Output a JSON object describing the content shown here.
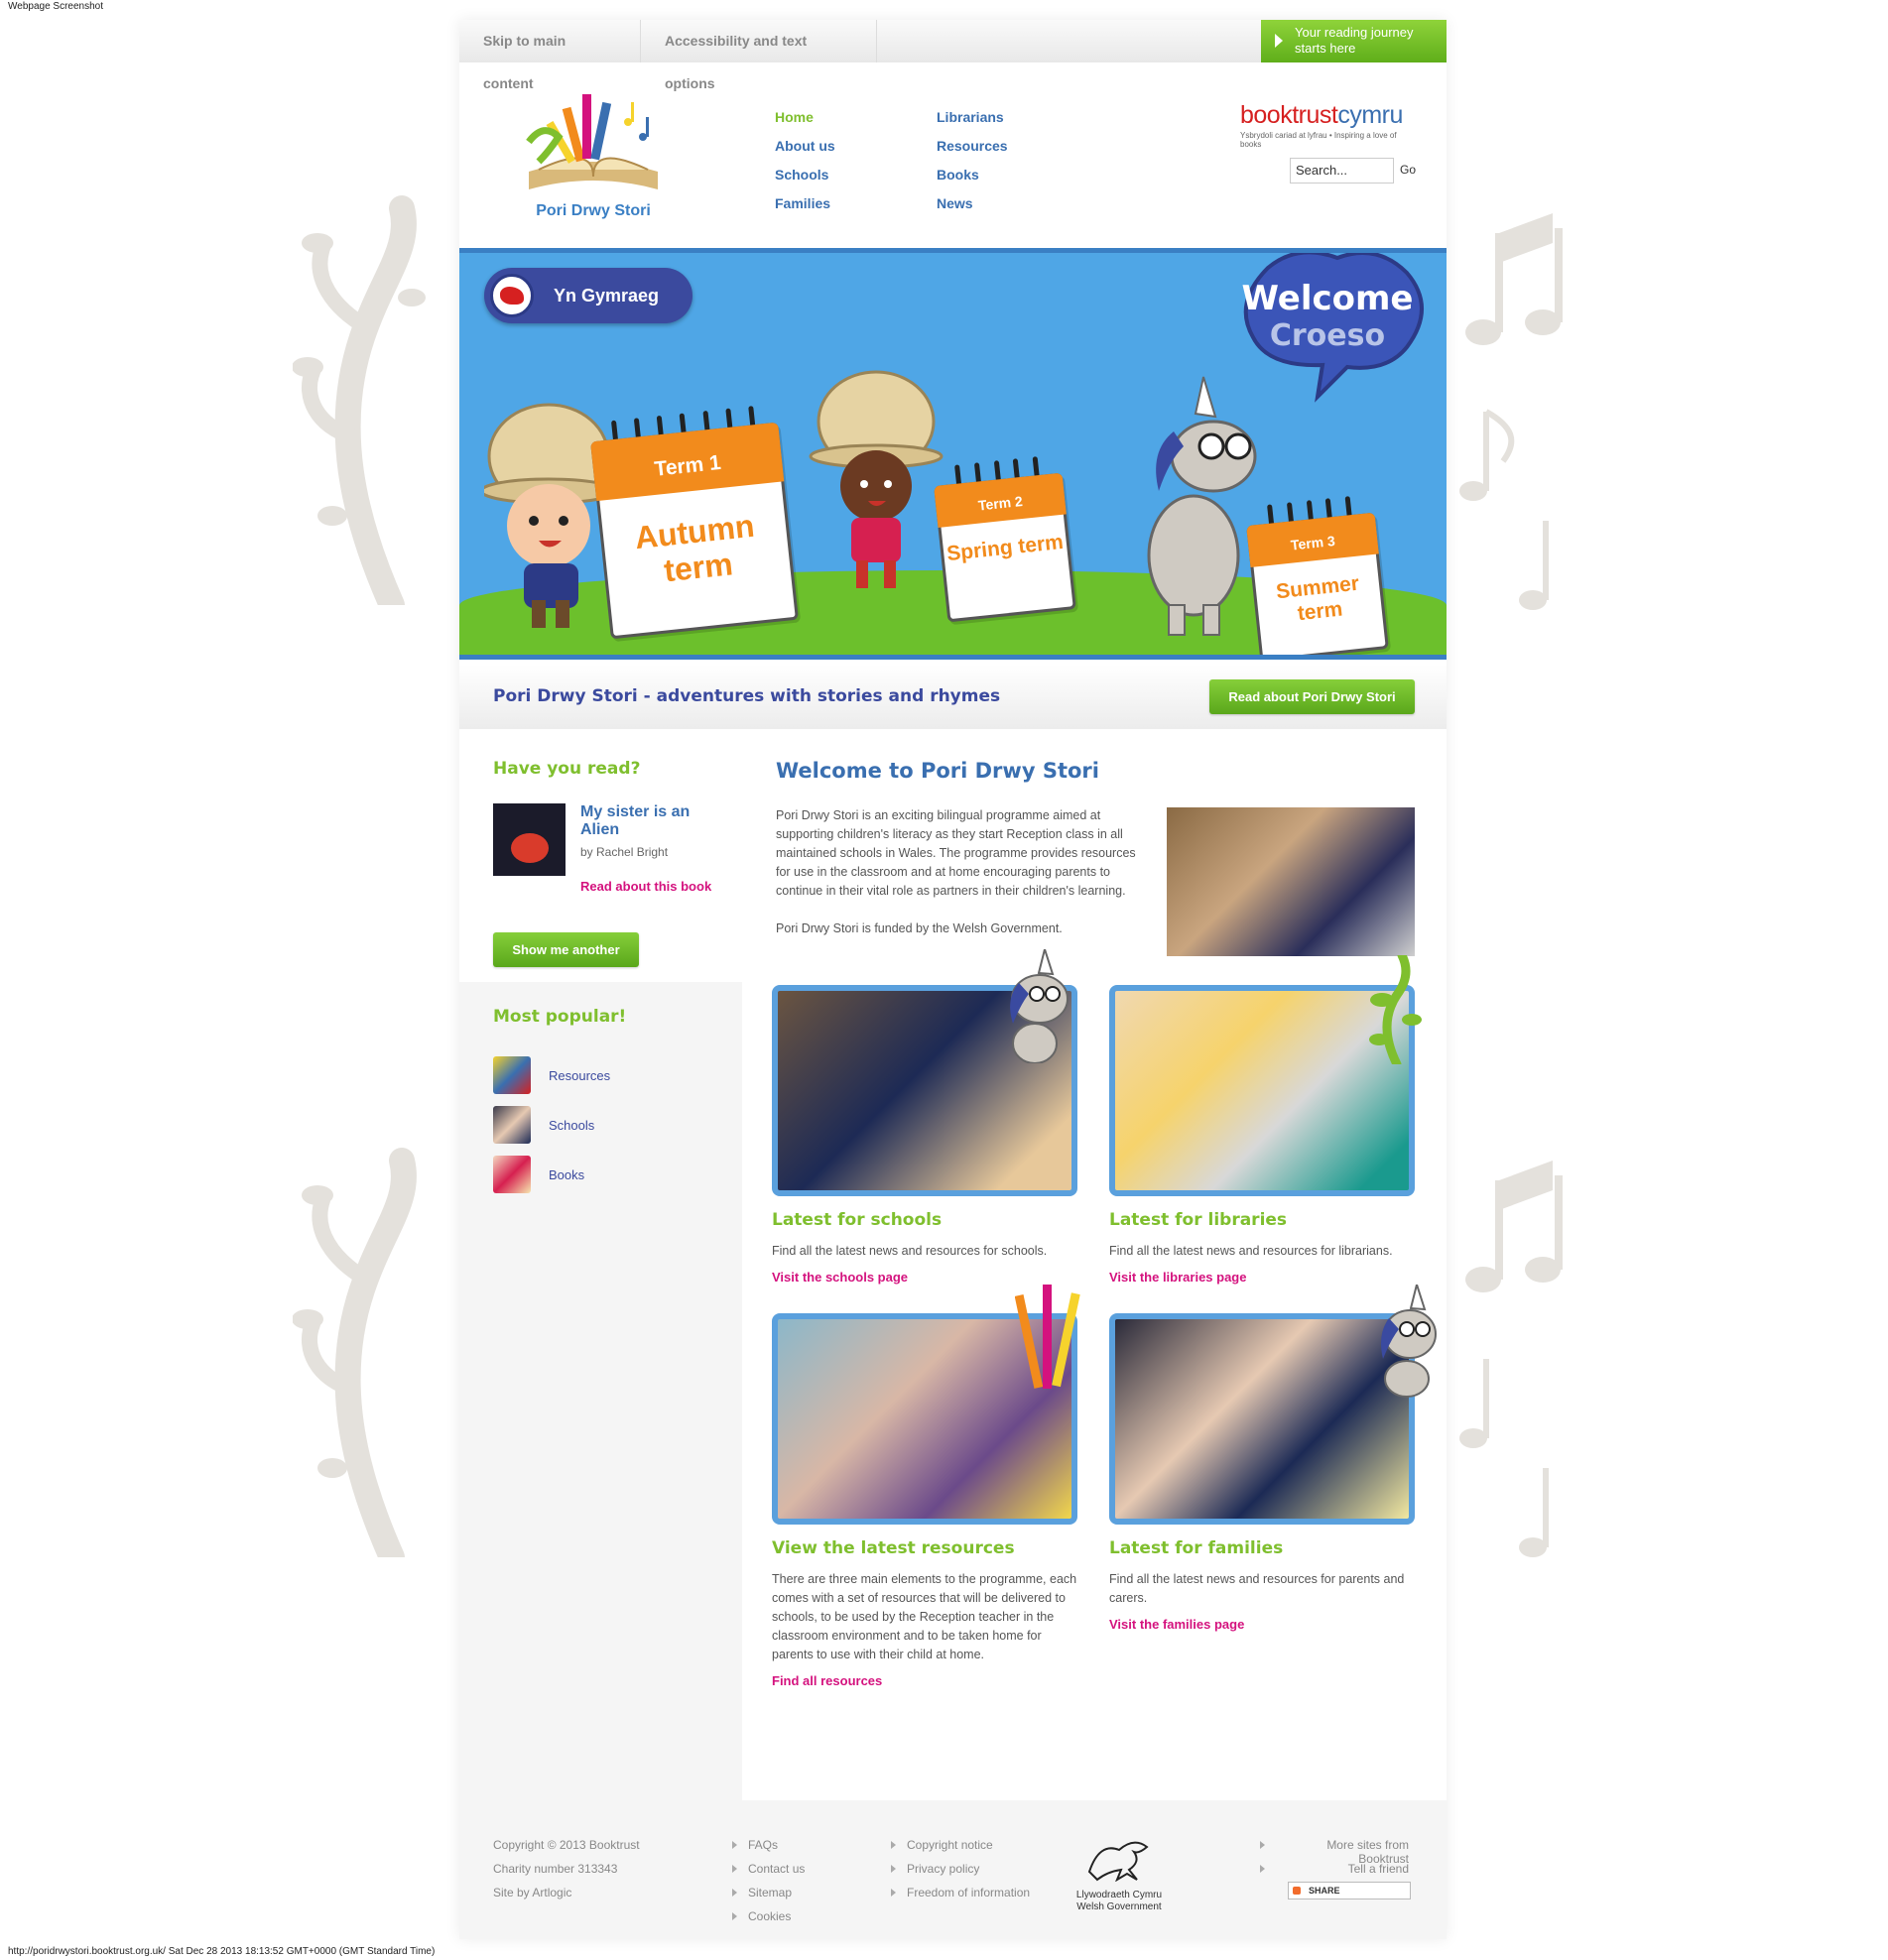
{
  "captions": {
    "top": "Webpage Screenshot",
    "bottom": "http://poridrwystori.booktrust.org.uk/ Sat Dec 28 2013 18:13:52 GMT+0000 (GMT Standard Time)"
  },
  "utility": {
    "skip": "Skip to main content",
    "accessibility": "Accessibility and text options",
    "journey": "Your reading journey starts here"
  },
  "logo": {
    "text": "Pori Drwy Stori"
  },
  "nav": {
    "col1": [
      "Home",
      "About us",
      "Schools",
      "Families"
    ],
    "col2": [
      "Librarians",
      "Resources",
      "Books",
      "News"
    ],
    "active": "Home"
  },
  "booktrust": {
    "name_a": "booktrust",
    "name_b": "cymru",
    "tagline": "Ysbrydoli cariad at lyfrau • Inspiring a love of books"
  },
  "search": {
    "placeholder": "Search...",
    "go": "Go"
  },
  "hero": {
    "language_button": "Yn Gymraeg",
    "welcome": "Welcome",
    "croeso": "Croeso",
    "terms": [
      {
        "head": "Term 1",
        "body": "Autumn term"
      },
      {
        "head": "Term 2",
        "body": "Spring term"
      },
      {
        "head": "Term 3",
        "body": "Summer term"
      }
    ]
  },
  "strap": {
    "text": "Pori Drwy Stori - adventures with stories and rhymes",
    "button": "Read about Pori Drwy Stori"
  },
  "sidebar": {
    "have_you_read": "Have you read?",
    "book_title": "My sister is an Alien",
    "book_author": "by Rachel Bright",
    "book_link": "Read about this book",
    "show_another": "Show me another",
    "most_popular": "Most popular!",
    "popular": [
      {
        "label": "Resources"
      },
      {
        "label": "Schools"
      },
      {
        "label": "Books"
      }
    ]
  },
  "main": {
    "title": "Welcome to Pori Drwy Stori",
    "intro_1": "Pori Drwy Stori is an exciting bilingual programme aimed at supporting children's literacy as they start Reception class in all maintained schools in Wales. The programme provides resources for use in the classroom and at home encouraging parents to continue in their vital role as partners in their children's learning.",
    "intro_2": "Pori Drwy Stori is funded by the Welsh Government.",
    "cards": [
      {
        "title": "Latest for schools",
        "text": "Find all the latest news and resources for schools.",
        "link": "Visit the schools page"
      },
      {
        "title": "Latest for libraries",
        "text": "Find all the latest news and resources for librarians.",
        "link": "Visit the libraries page"
      },
      {
        "title": "View the latest resources",
        "text": "There are three main elements to the programme, each comes with a set of resources that will be delivered to schools, to be used by the Reception teacher in the classroom environment and to be taken home for parents to use with their child at home.",
        "link": "Find all resources"
      },
      {
        "title": "Latest for families",
        "text": "Find all the latest news and resources for parents and carers.",
        "link": "Visit the families page"
      }
    ]
  },
  "footer": {
    "col1": [
      "Copyright © 2013 Booktrust",
      "Charity number 313343",
      "Site by Artlogic"
    ],
    "col2": [
      "FAQs",
      "Contact us",
      "Sitemap",
      "Cookies"
    ],
    "col3": [
      "Copyright notice",
      "Privacy policy",
      "Freedom of information"
    ],
    "welsh_gov_1": "Llywodraeth Cymru",
    "welsh_gov_2": "Welsh Government",
    "col5": [
      "More sites from Booktrust",
      "Tell a friend"
    ],
    "share": "SHARE"
  },
  "colors": {
    "green": "#7fbf2e",
    "blue": "#3a6fb0",
    "navy": "#3b4a9e",
    "magenta": "#d4127e",
    "orange": "#f28b1c"
  }
}
